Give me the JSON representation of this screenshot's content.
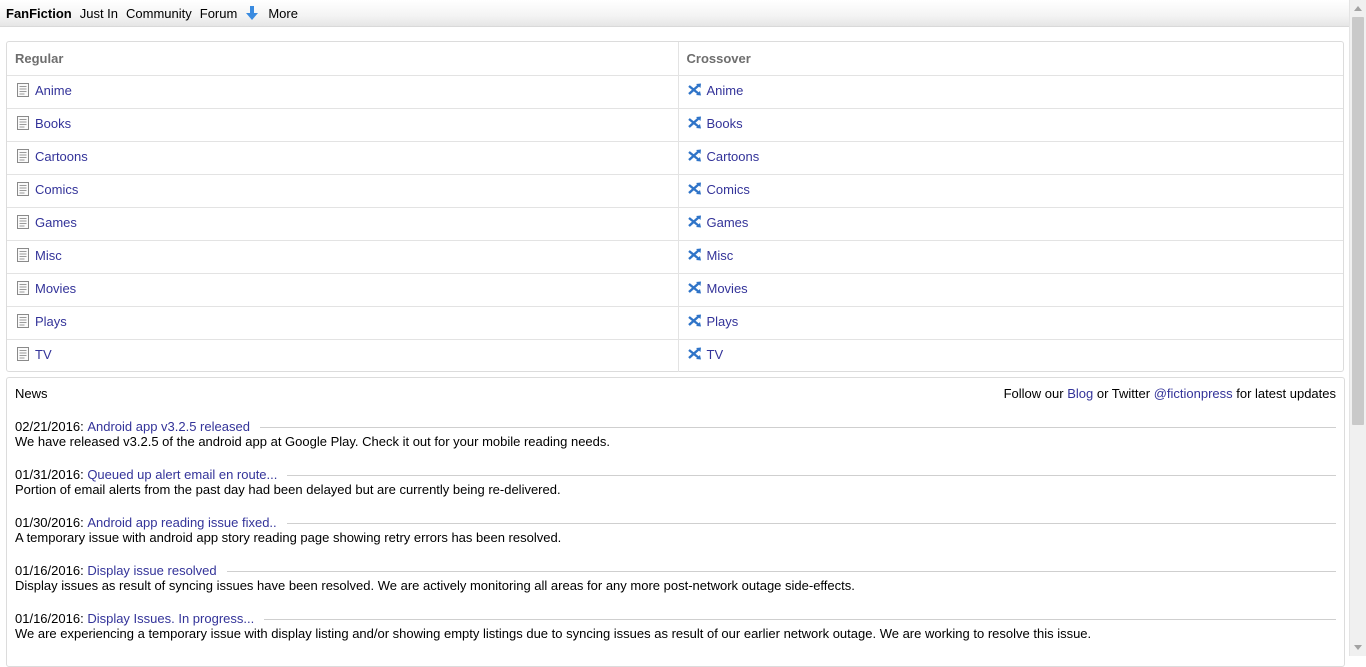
{
  "nav": {
    "brand": "FanFiction",
    "just_in": "Just In",
    "community": "Community",
    "forum": "Forum",
    "more": "More"
  },
  "categories": {
    "regular_header": "Regular",
    "crossover_header": "Crossover",
    "regular": [
      "Anime",
      "Books",
      "Cartoons",
      "Comics",
      "Games",
      "Misc",
      "Movies",
      "Plays",
      "TV"
    ],
    "crossover": [
      "Anime",
      "Books",
      "Cartoons",
      "Comics",
      "Games",
      "Misc",
      "Movies",
      "Plays",
      "TV"
    ]
  },
  "news": {
    "title": "News",
    "follow_prefix": "Follow our",
    "blog": "Blog",
    "follow_mid": "or Twitter",
    "twitter": "@fictionpress",
    "follow_suffix": "for latest updates",
    "items": [
      {
        "date": "02/21/2016:",
        "headline": "Android app v3.2.5 released",
        "body": "We have released v3.2.5 of the android app at Google Play. Check it out for your mobile reading needs."
      },
      {
        "date": "01/31/2016:",
        "headline": "Queued up alert email en route...",
        "body": "Portion of email alerts from the past day had been delayed but are currently being re-delivered."
      },
      {
        "date": "01/30/2016:",
        "headline": "Android app reading issue fixed..",
        "body": "A temporary issue with android app story reading page showing retry errors has been resolved."
      },
      {
        "date": "01/16/2016:",
        "headline": "Display issue resolved",
        "body": "Display issues as result of syncing issues have been resolved. We are actively monitoring all areas for any more post-network outage side-effects."
      },
      {
        "date": "01/16/2016:",
        "headline": "Display Issues. In progress...",
        "body": "We are experiencing a temporary issue with display listing and/or showing empty listings due to syncing issues as result of our earlier network outage. We are working to resolve this issue."
      }
    ]
  },
  "colors": {
    "link": "#333399",
    "header_text": "#6e6e6e",
    "crossover_icon": "#2f74c8"
  },
  "icons": {
    "regular": "document-icon",
    "crossover": "crossover-arrows-icon",
    "more": "down-arrow-icon"
  }
}
